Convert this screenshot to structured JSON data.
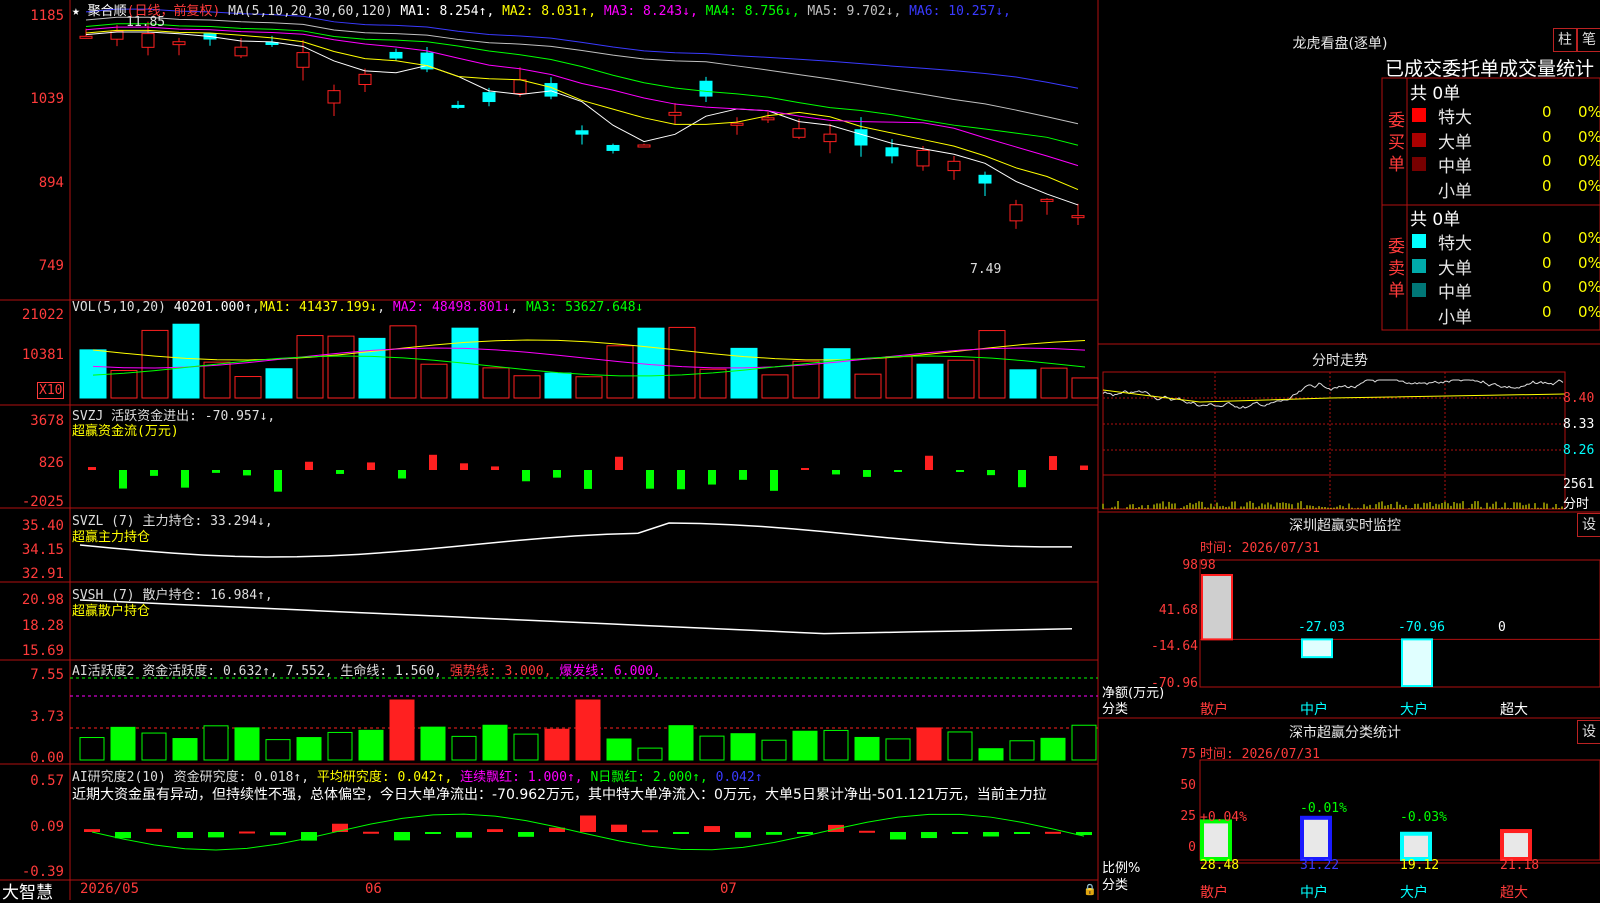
{
  "bottom_bar": {
    "logo": "大智慧",
    "dates": [
      "2026/05",
      "06",
      "07"
    ]
  },
  "kline": {
    "stock_name": "聚合顺",
    "period": "(日线，前复权)",
    "ma_prefix": "MA(5,10,20,30,60,120)",
    "ma": [
      {
        "label": "MA1: 8.254↑",
        "color": "#ffffff"
      },
      {
        "label": "MA2: 8.031↑",
        "color": "#ffff00"
      },
      {
        "label": "MA3: 8.243↓",
        "color": "#ff00ff"
      },
      {
        "label": "MA4: 8.756↓",
        "color": "#00ff00"
      },
      {
        "label": "MA5: 9.702↓",
        "color": "#c0c0c0"
      },
      {
        "label": "MA6: 10.257↓",
        "color": "#3a3aff"
      }
    ],
    "y_ticks": [
      "1185",
      "1039",
      "894",
      "749"
    ],
    "high_marker": "11.85",
    "low_marker": "7.49"
  },
  "vol": {
    "prefix": "VOL(5,10,20)",
    "value": "40201.000↑",
    "ma1": "MA1: 41437.199↓",
    "ma2": "MA2: 48498.801↓",
    "ma3": "MA3: 53627.648↓",
    "y_ticks": [
      "21022",
      "10381"
    ],
    "unit": "X10"
  },
  "svzj": {
    "title": "SVZJ  活跃资金进出: -70.957↓,",
    "subtitle": "超赢资金流(万元)",
    "y_ticks": [
      "3678",
      "826",
      "-2025"
    ]
  },
  "svzl": {
    "title": "SVZL (7) 主力持仓: 33.294↓,",
    "subtitle": "超赢主力持仓",
    "y_ticks": [
      "35.40",
      "34.15",
      "32.91"
    ]
  },
  "svsh": {
    "title": "SVSH (7) 散户持仓: 16.984↑,",
    "subtitle": "超赢散户持仓",
    "y_ticks": [
      "20.98",
      "18.28",
      "15.69"
    ]
  },
  "ai_active": {
    "title": "AI活跃度2 资金活跃度: 0.632↑, 7.552, 生命线: 1.560,",
    "strong": "强势线: 3.000,",
    "burst": "爆发线: 6.000,",
    "y_ticks": [
      "7.55",
      "3.73",
      "0.00"
    ]
  },
  "ai_research": {
    "title": "AI研究度2(10) 资金研究度: 0.018↑,",
    "avg": "平均研究度: 0.042↑,",
    "cont": "连续飘红: 1.000↑,",
    "nday": "N日飘红: 2.000↑,",
    "last": "0.042↑",
    "comment": "近期大资金虽有异动，但持续性不强，总体偏空，今日大单净流出：-70.962万元，其中特大单净流入：0万元，大单5日累计净出-501.121万元，当前主力拉",
    "y_ticks": [
      "0.57",
      "0.09",
      "-0.39"
    ]
  },
  "dragon_tiger": {
    "title": "龙虎看盘(逐单)",
    "btn_a": "柱",
    "btn_b": "笔",
    "tabs_text": "已成交委托单成交量统计",
    "buy_label": "委买单",
    "sell_label": "委卖单",
    "buy_total": "共 0单",
    "sell_total": "共 0单",
    "buy_rows": [
      {
        "name": "特大",
        "count": "0",
        "pct": "0%",
        "color": "#ff0000"
      },
      {
        "name": "大单",
        "count": "0",
        "pct": "0%",
        "color": "#aa0000"
      },
      {
        "name": "中单",
        "count": "0",
        "pct": "0%",
        "color": "#770000"
      },
      {
        "name": "小单",
        "count": "0",
        "pct": "0%",
        "color": "#000000"
      }
    ],
    "sell_rows": [
      {
        "name": "特大",
        "count": "0",
        "pct": "0%",
        "color": "#00ffff"
      },
      {
        "name": "大单",
        "count": "0",
        "pct": "0%",
        "color": "#00aaaa"
      },
      {
        "name": "中单",
        "count": "0",
        "pct": "0%",
        "color": "#007777"
      },
      {
        "name": "小单",
        "count": "0",
        "pct": "0%",
        "color": "#000000"
      }
    ]
  },
  "intraday": {
    "title": "分时走势",
    "y_ticks": [
      "8.40",
      "8.33",
      "8.26"
    ],
    "vol_top": "2561",
    "vol_label": "分时"
  },
  "sz_monitor": {
    "title": "深圳超赢实时监控",
    "set_btn": "设",
    "time": "时间: 2026/07/31",
    "y_ticks": [
      "98",
      "41.68",
      "-14.64",
      "-70.96"
    ],
    "bar_labels": [
      "98",
      "-27.03",
      "-70.96",
      "0"
    ],
    "categories": [
      "散户",
      "中户",
      "大户",
      "超大"
    ],
    "ylabel": "净额(万元)",
    "xlabel": "分类"
  },
  "sz_class": {
    "title": "深市超赢分类统计",
    "set_btn": "设",
    "time": "时间: 2026/07/31",
    "y_ticks": [
      "75",
      "50",
      "25",
      "0"
    ],
    "deltas": [
      "+0.04%",
      "-0.01%",
      "-0.03%",
      ""
    ],
    "values": [
      "28.48",
      "31.22",
      "19.12",
      "21.18"
    ],
    "categories": [
      "散户",
      "中户",
      "大户",
      "超大"
    ],
    "ylabel": "比例%",
    "xlabel": "分类"
  },
  "chart_data": [
    {
      "type": "line",
      "title": "聚合顺(日线，前复权)",
      "x": [
        "2026/05",
        "06",
        "07"
      ],
      "series": [
        {
          "name": "MA1",
          "values": [
            8.254
          ]
        },
        {
          "name": "MA2",
          "values": [
            8.031
          ]
        },
        {
          "name": "MA3",
          "values": [
            8.243
          ]
        },
        {
          "name": "MA4",
          "values": [
            8.756
          ]
        },
        {
          "name": "MA5",
          "values": [
            9.702
          ]
        },
        {
          "name": "MA6",
          "values": [
            10.257
          ]
        }
      ],
      "ylim": [
        7.49,
        11.85
      ]
    },
    {
      "type": "bar",
      "title": "深圳超赢实时监控",
      "categories": [
        "散户",
        "中户",
        "大户",
        "超大"
      ],
      "values": [
        98,
        -27.03,
        -70.96,
        0
      ],
      "ylabel": "净额(万元)",
      "ylim": [
        -70.96,
        98
      ]
    },
    {
      "type": "bar",
      "title": "深市超赢分类统计",
      "categories": [
        "散户",
        "中户",
        "大户",
        "超大"
      ],
      "values": [
        28.48,
        31.22,
        19.12,
        21.18
      ],
      "ylabel": "比例%",
      "ylim": [
        0,
        75
      ]
    }
  ]
}
